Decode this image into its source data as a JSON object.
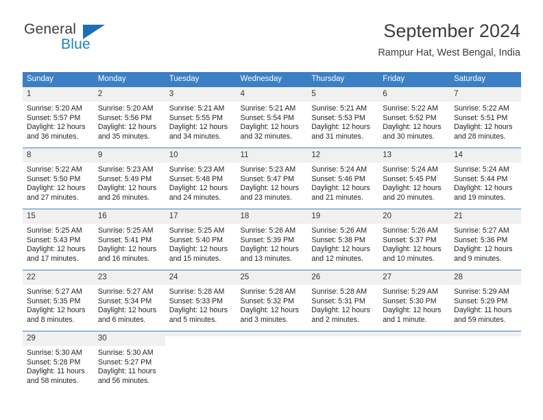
{
  "brand": {
    "line1": "General",
    "line2": "Blue",
    "accent_color": "#1b6fb5",
    "text_color": "#3b3b3b"
  },
  "header": {
    "title": "September 2024",
    "subtitle": "Rampur Hat, West Bengal, India"
  },
  "calendar": {
    "header_bg": "#3b7fc4",
    "daynum_bg": "#f0f0f0",
    "weekday_headers": [
      "Sunday",
      "Monday",
      "Tuesday",
      "Wednesday",
      "Thursday",
      "Friday",
      "Saturday"
    ],
    "weeks": [
      [
        {
          "day": "1",
          "sunrise": "Sunrise: 5:20 AM",
          "sunset": "Sunset: 5:57 PM",
          "daylight_1": "Daylight: 12 hours",
          "daylight_2": "and 36 minutes."
        },
        {
          "day": "2",
          "sunrise": "Sunrise: 5:20 AM",
          "sunset": "Sunset: 5:56 PM",
          "daylight_1": "Daylight: 12 hours",
          "daylight_2": "and 35 minutes."
        },
        {
          "day": "3",
          "sunrise": "Sunrise: 5:21 AM",
          "sunset": "Sunset: 5:55 PM",
          "daylight_1": "Daylight: 12 hours",
          "daylight_2": "and 34 minutes."
        },
        {
          "day": "4",
          "sunrise": "Sunrise: 5:21 AM",
          "sunset": "Sunset: 5:54 PM",
          "daylight_1": "Daylight: 12 hours",
          "daylight_2": "and 32 minutes."
        },
        {
          "day": "5",
          "sunrise": "Sunrise: 5:21 AM",
          "sunset": "Sunset: 5:53 PM",
          "daylight_1": "Daylight: 12 hours",
          "daylight_2": "and 31 minutes."
        },
        {
          "day": "6",
          "sunrise": "Sunrise: 5:22 AM",
          "sunset": "Sunset: 5:52 PM",
          "daylight_1": "Daylight: 12 hours",
          "daylight_2": "and 30 minutes."
        },
        {
          "day": "7",
          "sunrise": "Sunrise: 5:22 AM",
          "sunset": "Sunset: 5:51 PM",
          "daylight_1": "Daylight: 12 hours",
          "daylight_2": "and 28 minutes."
        }
      ],
      [
        {
          "day": "8",
          "sunrise": "Sunrise: 5:22 AM",
          "sunset": "Sunset: 5:50 PM",
          "daylight_1": "Daylight: 12 hours",
          "daylight_2": "and 27 minutes."
        },
        {
          "day": "9",
          "sunrise": "Sunrise: 5:23 AM",
          "sunset": "Sunset: 5:49 PM",
          "daylight_1": "Daylight: 12 hours",
          "daylight_2": "and 26 minutes."
        },
        {
          "day": "10",
          "sunrise": "Sunrise: 5:23 AM",
          "sunset": "Sunset: 5:48 PM",
          "daylight_1": "Daylight: 12 hours",
          "daylight_2": "and 24 minutes."
        },
        {
          "day": "11",
          "sunrise": "Sunrise: 5:23 AM",
          "sunset": "Sunset: 5:47 PM",
          "daylight_1": "Daylight: 12 hours",
          "daylight_2": "and 23 minutes."
        },
        {
          "day": "12",
          "sunrise": "Sunrise: 5:24 AM",
          "sunset": "Sunset: 5:46 PM",
          "daylight_1": "Daylight: 12 hours",
          "daylight_2": "and 21 minutes."
        },
        {
          "day": "13",
          "sunrise": "Sunrise: 5:24 AM",
          "sunset": "Sunset: 5:45 PM",
          "daylight_1": "Daylight: 12 hours",
          "daylight_2": "and 20 minutes."
        },
        {
          "day": "14",
          "sunrise": "Sunrise: 5:24 AM",
          "sunset": "Sunset: 5:44 PM",
          "daylight_1": "Daylight: 12 hours",
          "daylight_2": "and 19 minutes."
        }
      ],
      [
        {
          "day": "15",
          "sunrise": "Sunrise: 5:25 AM",
          "sunset": "Sunset: 5:43 PM",
          "daylight_1": "Daylight: 12 hours",
          "daylight_2": "and 17 minutes."
        },
        {
          "day": "16",
          "sunrise": "Sunrise: 5:25 AM",
          "sunset": "Sunset: 5:41 PM",
          "daylight_1": "Daylight: 12 hours",
          "daylight_2": "and 16 minutes."
        },
        {
          "day": "17",
          "sunrise": "Sunrise: 5:25 AM",
          "sunset": "Sunset: 5:40 PM",
          "daylight_1": "Daylight: 12 hours",
          "daylight_2": "and 15 minutes."
        },
        {
          "day": "18",
          "sunrise": "Sunrise: 5:26 AM",
          "sunset": "Sunset: 5:39 PM",
          "daylight_1": "Daylight: 12 hours",
          "daylight_2": "and 13 minutes."
        },
        {
          "day": "19",
          "sunrise": "Sunrise: 5:26 AM",
          "sunset": "Sunset: 5:38 PM",
          "daylight_1": "Daylight: 12 hours",
          "daylight_2": "and 12 minutes."
        },
        {
          "day": "20",
          "sunrise": "Sunrise: 5:26 AM",
          "sunset": "Sunset: 5:37 PM",
          "daylight_1": "Daylight: 12 hours",
          "daylight_2": "and 10 minutes."
        },
        {
          "day": "21",
          "sunrise": "Sunrise: 5:27 AM",
          "sunset": "Sunset: 5:36 PM",
          "daylight_1": "Daylight: 12 hours",
          "daylight_2": "and 9 minutes."
        }
      ],
      [
        {
          "day": "22",
          "sunrise": "Sunrise: 5:27 AM",
          "sunset": "Sunset: 5:35 PM",
          "daylight_1": "Daylight: 12 hours",
          "daylight_2": "and 8 minutes."
        },
        {
          "day": "23",
          "sunrise": "Sunrise: 5:27 AM",
          "sunset": "Sunset: 5:34 PM",
          "daylight_1": "Daylight: 12 hours",
          "daylight_2": "and 6 minutes."
        },
        {
          "day": "24",
          "sunrise": "Sunrise: 5:28 AM",
          "sunset": "Sunset: 5:33 PM",
          "daylight_1": "Daylight: 12 hours",
          "daylight_2": "and 5 minutes."
        },
        {
          "day": "25",
          "sunrise": "Sunrise: 5:28 AM",
          "sunset": "Sunset: 5:32 PM",
          "daylight_1": "Daylight: 12 hours",
          "daylight_2": "and 3 minutes."
        },
        {
          "day": "26",
          "sunrise": "Sunrise: 5:28 AM",
          "sunset": "Sunset: 5:31 PM",
          "daylight_1": "Daylight: 12 hours",
          "daylight_2": "and 2 minutes."
        },
        {
          "day": "27",
          "sunrise": "Sunrise: 5:29 AM",
          "sunset": "Sunset: 5:30 PM",
          "daylight_1": "Daylight: 12 hours",
          "daylight_2": "and 1 minute."
        },
        {
          "day": "28",
          "sunrise": "Sunrise: 5:29 AM",
          "sunset": "Sunset: 5:29 PM",
          "daylight_1": "Daylight: 11 hours",
          "daylight_2": "and 59 minutes."
        }
      ],
      [
        {
          "day": "29",
          "sunrise": "Sunrise: 5:30 AM",
          "sunset": "Sunset: 5:28 PM",
          "daylight_1": "Daylight: 11 hours",
          "daylight_2": "and 58 minutes."
        },
        {
          "day": "30",
          "sunrise": "Sunrise: 5:30 AM",
          "sunset": "Sunset: 5:27 PM",
          "daylight_1": "Daylight: 11 hours",
          "daylight_2": "and 56 minutes."
        },
        {
          "day": "",
          "sunrise": "",
          "sunset": "",
          "daylight_1": "",
          "daylight_2": ""
        },
        {
          "day": "",
          "sunrise": "",
          "sunset": "",
          "daylight_1": "",
          "daylight_2": ""
        },
        {
          "day": "",
          "sunrise": "",
          "sunset": "",
          "daylight_1": "",
          "daylight_2": ""
        },
        {
          "day": "",
          "sunrise": "",
          "sunset": "",
          "daylight_1": "",
          "daylight_2": ""
        },
        {
          "day": "",
          "sunrise": "",
          "sunset": "",
          "daylight_1": "",
          "daylight_2": ""
        }
      ]
    ]
  }
}
